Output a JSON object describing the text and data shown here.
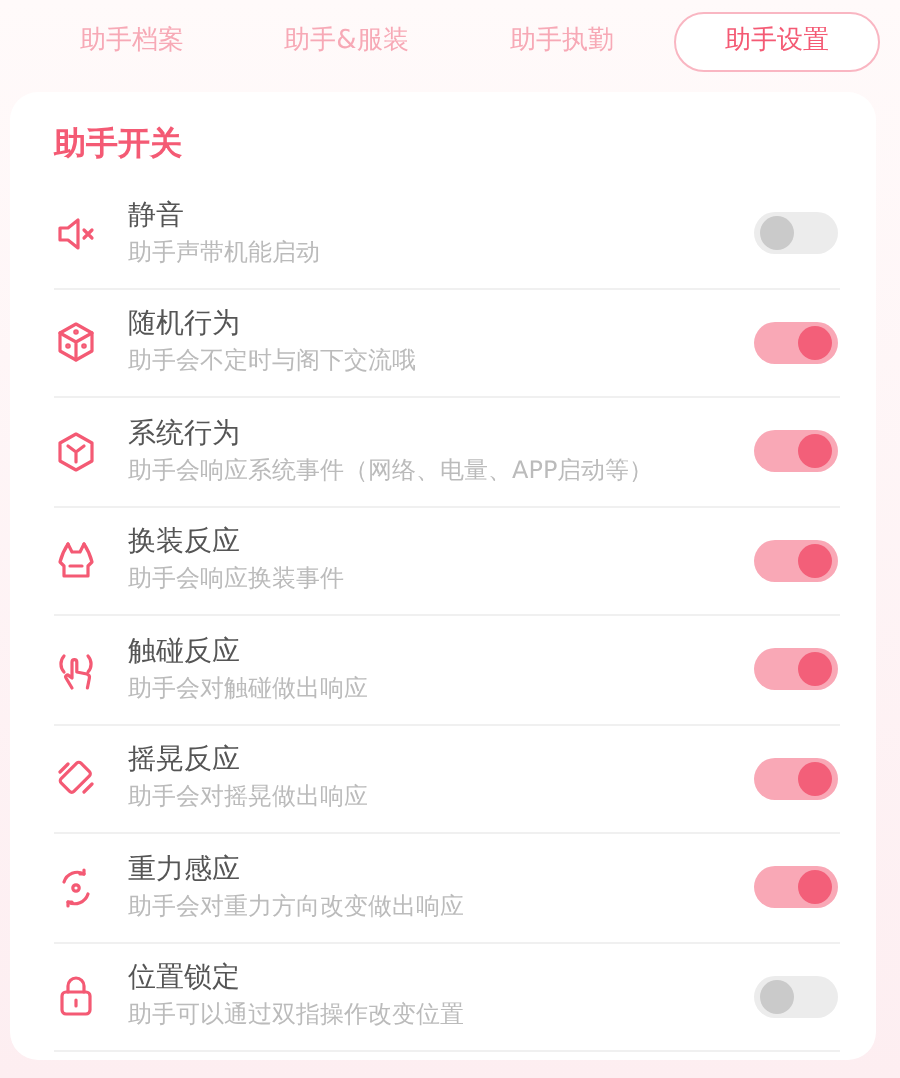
{
  "tabs": [
    {
      "label": "助手档案",
      "selected": false
    },
    {
      "label": "助手&服装",
      "selected": false
    },
    {
      "label": "助手执勤",
      "selected": false
    },
    {
      "label": "助手设置",
      "selected": true
    }
  ],
  "section": {
    "title": "助手开关",
    "items": [
      {
        "title": "静音",
        "description": "助手声带机能启动",
        "on": false
      },
      {
        "title": "随机行为",
        "description": "助手会不定时与阁下交流哦",
        "on": true
      },
      {
        "title": "系统行为",
        "description": "助手会响应系统事件（网络、电量、APP启动等）",
        "on": true
      },
      {
        "title": "换装反应",
        "description": "助手会响应换装事件",
        "on": true
      },
      {
        "title": "触碰反应",
        "description": "助手会对触碰做出响应",
        "on": true
      },
      {
        "title": "摇晃反应",
        "description": "助手会对摇晃做出响应",
        "on": true
      },
      {
        "title": "重力感应",
        "description": "助手会对重力方向改变做出响应",
        "on": true
      },
      {
        "title": "位置锁定",
        "description": "助手可以通过双指操作改变位置",
        "on": false
      }
    ]
  }
}
